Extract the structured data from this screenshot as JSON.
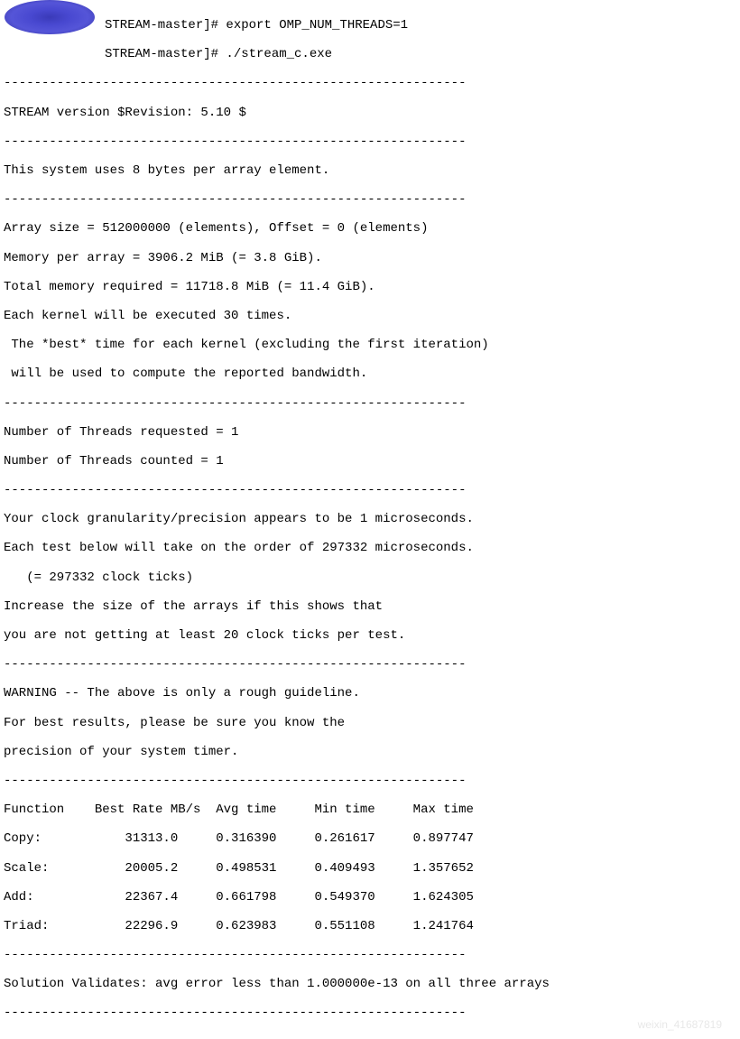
{
  "prompt1": "STREAM-master]# export OMP_NUM_THREADS=1",
  "prompt2": "STREAM-master]# ./stream_c.exe",
  "divider": "-------------------------------------------------------------",
  "version_line": "STREAM version $Revision: 5.10 $",
  "system_line": "This system uses 8 bytes per array element.",
  "array_size": "Array size = 512000000 (elements), Offset = 0 (elements)",
  "mem_per_array": "Memory per array = 3906.2 MiB (= 3.8 GiB).",
  "total_mem": "Total memory required = 11718.8 MiB (= 11.4 GiB).",
  "kernel_exec": "Each kernel will be executed 30 times.",
  "best_time1": " The *best* time for each kernel (excluding the first iteration)",
  "best_time2": " will be used to compute the reported bandwidth.",
  "threads_req": "Number of Threads requested = 1",
  "threads_cnt": "Number of Threads counted = 1",
  "clock_gran": "Your clock granularity/precision appears to be 1 microseconds.",
  "test_order": "Each test below will take on the order of 297332 microseconds.",
  "clock_ticks": "   (= 297332 clock ticks)",
  "increase": "Increase the size of the arrays if this shows that",
  "not_getting": "you are not getting at least 20 clock ticks per test.",
  "warning": "WARNING -- The above is only a rough guideline.",
  "best_results": "For best results, please be sure you know the",
  "precision": "precision of your system timer.",
  "header_line": "Function    Best Rate MB/s  Avg time     Min time     Max time",
  "results": {
    "copy": "Copy:           31313.0     0.316390     0.261617     0.897747",
    "scale": "Scale:          20005.2     0.498531     0.409493     1.357652",
    "add": "Add:            22367.4     0.661798     0.549370     1.624305",
    "triad": "Triad:          22296.9     0.623983     0.551108     1.241764"
  },
  "solution": "Solution Validates: avg error less than 1.000000e-13 on all three arrays",
  "watermark": "weixin_41687819",
  "chart_data": {
    "type": "table",
    "title": "STREAM Benchmark Results",
    "columns": [
      "Function",
      "Best Rate MB/s",
      "Avg time",
      "Min time",
      "Max time"
    ],
    "rows": [
      {
        "function": "Copy",
        "best_rate": 31313.0,
        "avg_time": 0.31639,
        "min_time": 0.261617,
        "max_time": 0.897747
      },
      {
        "function": "Scale",
        "best_rate": 20005.2,
        "avg_time": 0.498531,
        "min_time": 0.409493,
        "max_time": 1.357652
      },
      {
        "function": "Add",
        "best_rate": 22367.4,
        "avg_time": 0.661798,
        "min_time": 0.54937,
        "max_time": 1.624305
      },
      {
        "function": "Triad",
        "best_rate": 22296.9,
        "avg_time": 0.623983,
        "min_time": 0.551108,
        "max_time": 1.241764
      }
    ],
    "config": {
      "array_size": 512000000,
      "offset": 0,
      "bytes_per_element": 8,
      "memory_per_array_mib": 3906.2,
      "memory_per_array_gib": 3.8,
      "total_memory_mib": 11718.8,
      "total_memory_gib": 11.4,
      "kernel_iterations": 30,
      "threads_requested": 1,
      "threads_counted": 1,
      "clock_granularity_us": 1,
      "test_duration_us": 297332,
      "clock_ticks": 297332,
      "omp_num_threads": 1,
      "stream_version": "5.10"
    }
  }
}
